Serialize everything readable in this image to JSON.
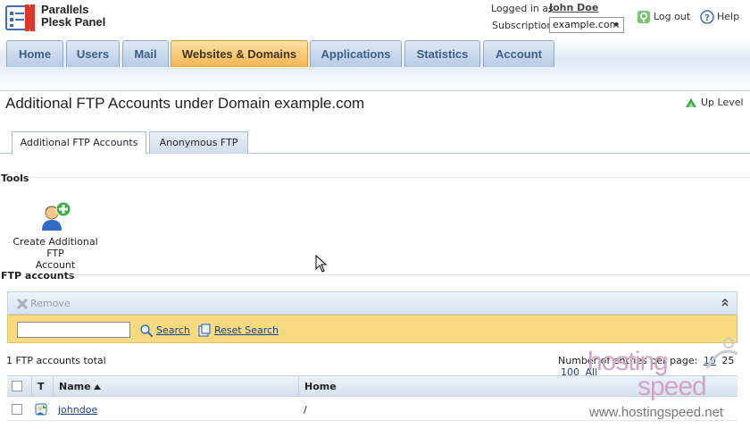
{
  "header": {
    "brand_line1": "Parallels",
    "brand_line2": "Plesk Panel",
    "logged_in_label": "Logged in as",
    "user_name": "John Doe",
    "subscription_label": "Subscription",
    "subscription_value": "example.com",
    "logout_label": "Log out",
    "help_label": "Help"
  },
  "nav": {
    "tabs": [
      {
        "label": "Home"
      },
      {
        "label": "Users"
      },
      {
        "label": "Mail"
      },
      {
        "label": "Websites & Domains",
        "active": true
      },
      {
        "label": "Applications"
      },
      {
        "label": "Statistics"
      },
      {
        "label": "Account"
      }
    ]
  },
  "page": {
    "title": "Additional FTP Accounts under Domain example.com",
    "up_level": "Up Level"
  },
  "subtabs": [
    {
      "label": "Additional FTP Accounts",
      "active": true
    },
    {
      "label": "Anonymous FTP"
    }
  ],
  "tools": {
    "heading": "Tools",
    "items": [
      {
        "label_line1": "Create Additional FTP",
        "label_line2": "Account",
        "icon": "add-user-icon"
      }
    ]
  },
  "ftp": {
    "heading": "FTP accounts",
    "remove_label": "Remove",
    "search_value": "",
    "search_label": "Search",
    "reset_label": "Reset Search",
    "total_text": "1 FTP accounts total",
    "per_page_label": "Number of entries per page:",
    "per_page_options": [
      "10",
      "25",
      "100",
      "All"
    ],
    "columns": {
      "type": "T",
      "name": "Name",
      "home": "Home"
    },
    "rows": [
      {
        "name": "johndoe",
        "home": "/"
      }
    ]
  },
  "watermark": {
    "word1": "hosting",
    "word2": "speed",
    "url": "www.hostingspeed.net"
  },
  "colors": {
    "active_tab": "#f9b550",
    "tab": "#b6cbe3",
    "search_bar": "#f8db80",
    "link": "#1a3d8f"
  }
}
